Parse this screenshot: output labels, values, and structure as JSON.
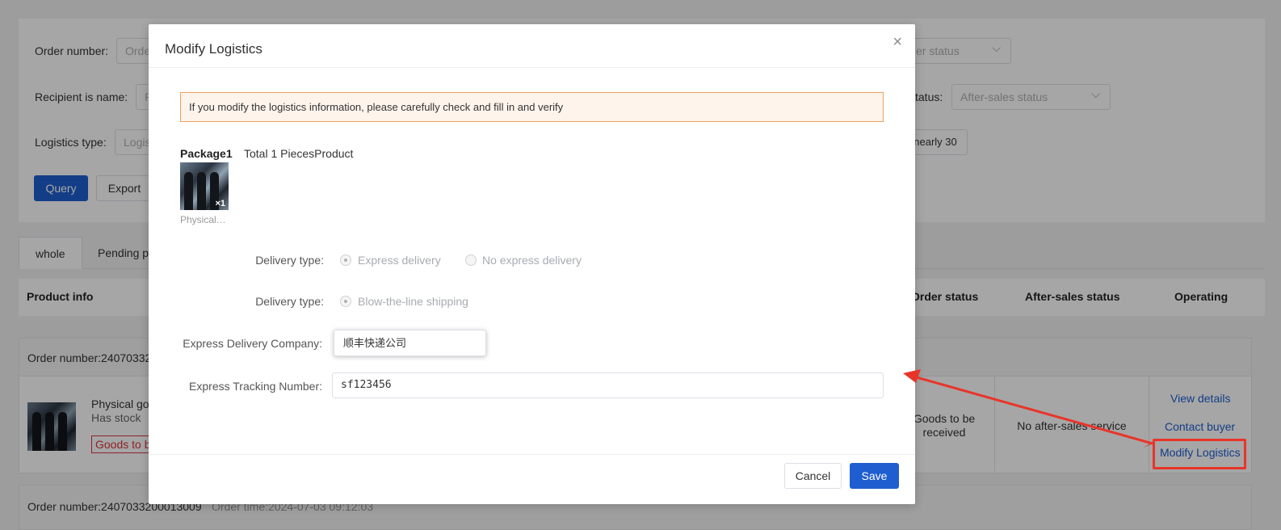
{
  "filters": {
    "order_number_label": "Order number:",
    "order_number_placeholder": "Orde",
    "order_status_placeholder": "er status",
    "recipient_label": "Recipient is name:",
    "recipient_placeholder": "R",
    "after_sales_label": "tatus:",
    "after_sales_placeholder": "After-sales status",
    "logistics_label": "Logistics type:",
    "logistics_placeholder": "Logis",
    "nearly30": "nearly 30",
    "query_label": "Query",
    "export_label": "Export"
  },
  "tabs": {
    "whole": "whole",
    "pending": "Pending p"
  },
  "table_headers": {
    "product_info": "Product info",
    "order_status": "Order status",
    "after_sales_status": "After-sales status",
    "operating": "Operating"
  },
  "order1": {
    "number": "Order number:24070332",
    "product_name": "Physical go",
    "stock": "Has stock",
    "tag": "Goods to b",
    "status": "Goods to be received",
    "after_sales": "No after-sales service",
    "view_details": "View details",
    "contact_buyer": "Contact buyer",
    "modify_logistics": "Modify Logistics"
  },
  "order2": {
    "number": "Order number:2407033200013009",
    "time": "Order time:2024-07-03 09:12:03"
  },
  "modal": {
    "title": "Modify Logistics",
    "close_glyph": "×",
    "notice": "If you modify the logistics information, please carefully check and fill in and verify",
    "package_title": "Package1",
    "package_total": "Total 1 PiecesProduct",
    "item_qty": "×1",
    "item_caption": "Physical…",
    "delivery_type_label": "Delivery type:",
    "opt_express": "Express delivery",
    "opt_no_express": "No express delivery",
    "delivery_type2_label": "Delivery type:",
    "opt_blow_line": "Blow-the-line shipping",
    "company_label": "Express Delivery Company:",
    "company_value": "顺丰快递公司",
    "tracking_label": "Express Tracking Number:",
    "tracking_value": "sf123456",
    "cancel_label": "Cancel",
    "save_label": "Save"
  },
  "colors": {
    "primary": "#1f5ed0",
    "annotation": "#e8352a",
    "notice_bg": "#fff4ec",
    "notice_border": "#f0a05a"
  }
}
